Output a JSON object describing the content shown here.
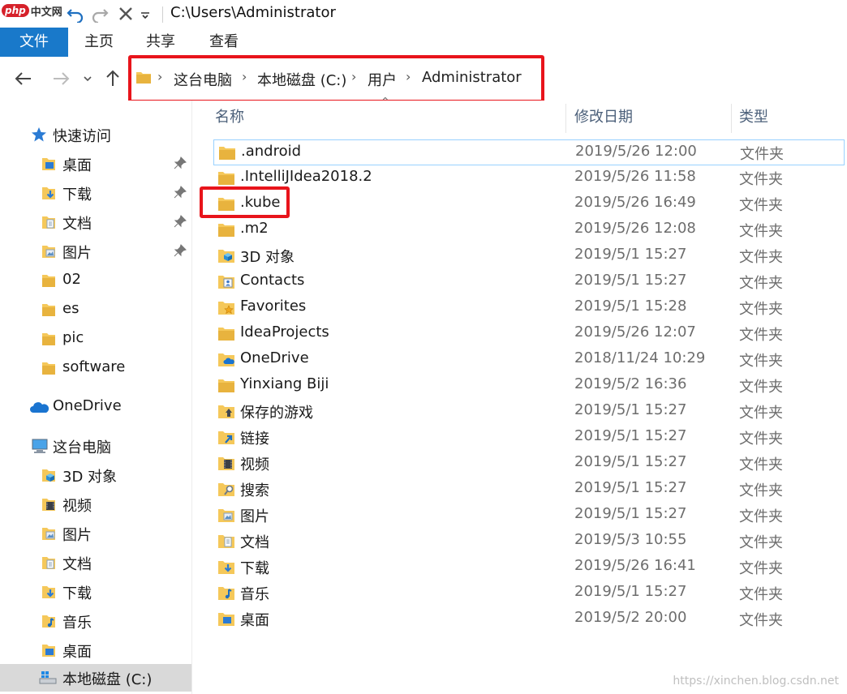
{
  "window": {
    "title": "C:\\Users\\Administrator"
  },
  "logo": {
    "badge": "php",
    "text": "中文网"
  },
  "ribbon": {
    "tabs": [
      "文件",
      "主页",
      "共享",
      "查看"
    ]
  },
  "address": {
    "breadcrumbs": [
      "这台电脑",
      "本地磁盘 (C:)",
      "用户",
      "Administrator"
    ]
  },
  "sidebar": {
    "quick_access": {
      "label": "快速访问",
      "items": [
        {
          "label": "桌面",
          "icon": "desktop-folder-icon",
          "pinned": true
        },
        {
          "label": "下载",
          "icon": "downloads-folder-icon",
          "pinned": true
        },
        {
          "label": "文档",
          "icon": "documents-folder-icon",
          "pinned": true
        },
        {
          "label": "图片",
          "icon": "pictures-folder-icon",
          "pinned": true
        },
        {
          "label": "02",
          "icon": "folder-icon",
          "pinned": false
        },
        {
          "label": "es",
          "icon": "folder-icon",
          "pinned": false
        },
        {
          "label": "pic",
          "icon": "folder-icon",
          "pinned": false
        },
        {
          "label": "software",
          "icon": "folder-icon",
          "pinned": false
        }
      ]
    },
    "onedrive": {
      "label": "OneDrive"
    },
    "this_pc": {
      "label": "这台电脑",
      "items": [
        {
          "label": "3D 对象",
          "icon": "3d-objects-folder-icon"
        },
        {
          "label": "视频",
          "icon": "videos-folder-icon"
        },
        {
          "label": "图片",
          "icon": "pictures-folder-icon"
        },
        {
          "label": "文档",
          "icon": "documents-folder-icon"
        },
        {
          "label": "下载",
          "icon": "downloads-folder-icon"
        },
        {
          "label": "音乐",
          "icon": "music-folder-icon"
        },
        {
          "label": "桌面",
          "icon": "desktop-folder-icon"
        },
        {
          "label": "本地磁盘 (C:)",
          "icon": "windows-drive-icon",
          "selected": true
        }
      ]
    }
  },
  "columns": {
    "name": "名称",
    "modified": "修改日期",
    "type": "类型"
  },
  "files": [
    {
      "name": ".android",
      "modified": "2019/5/26 12:00",
      "type": "文件夹",
      "icon": "folder-icon",
      "focused": true
    },
    {
      "name": ".IntelliJIdea2018.2",
      "modified": "2019/5/26 11:58",
      "type": "文件夹",
      "icon": "folder-icon"
    },
    {
      "name": ".kube",
      "modified": "2019/5/26 16:49",
      "type": "文件夹",
      "icon": "folder-icon",
      "highlighted": true
    },
    {
      "name": ".m2",
      "modified": "2019/5/26 12:08",
      "type": "文件夹",
      "icon": "folder-icon"
    },
    {
      "name": "3D 对象",
      "modified": "2019/5/1 15:27",
      "type": "文件夹",
      "icon": "3d-objects-folder-icon"
    },
    {
      "name": "Contacts",
      "modified": "2019/5/1 15:27",
      "type": "文件夹",
      "icon": "contacts-folder-icon"
    },
    {
      "name": "Favorites",
      "modified": "2019/5/1 15:28",
      "type": "文件夹",
      "icon": "favorites-folder-icon"
    },
    {
      "name": "IdeaProjects",
      "modified": "2019/5/26 12:07",
      "type": "文件夹",
      "icon": "folder-icon"
    },
    {
      "name": "OneDrive",
      "modified": "2018/11/24 10:29",
      "type": "文件夹",
      "icon": "onedrive-folder-icon"
    },
    {
      "name": "Yinxiang Biji",
      "modified": "2019/5/2 16:36",
      "type": "文件夹",
      "icon": "folder-icon"
    },
    {
      "name": "保存的游戏",
      "modified": "2019/5/1 15:27",
      "type": "文件夹",
      "icon": "saved-games-folder-icon"
    },
    {
      "name": "链接",
      "modified": "2019/5/1 15:27",
      "type": "文件夹",
      "icon": "links-folder-icon"
    },
    {
      "name": "视频",
      "modified": "2019/5/1 15:27",
      "type": "文件夹",
      "icon": "videos-folder-icon"
    },
    {
      "name": "搜索",
      "modified": "2019/5/1 15:27",
      "type": "文件夹",
      "icon": "searches-folder-icon"
    },
    {
      "name": "图片",
      "modified": "2019/5/1 15:27",
      "type": "文件夹",
      "icon": "pictures-folder-icon"
    },
    {
      "name": "文档",
      "modified": "2019/5/3 10:55",
      "type": "文件夹",
      "icon": "documents-folder-icon"
    },
    {
      "name": "下载",
      "modified": "2019/5/26 16:41",
      "type": "文件夹",
      "icon": "downloads-folder-icon"
    },
    {
      "name": "音乐",
      "modified": "2019/5/1 15:27",
      "type": "文件夹",
      "icon": "music-folder-icon"
    },
    {
      "name": "桌面",
      "modified": "2019/5/2 20:00",
      "type": "文件夹",
      "icon": "desktop-folder-icon"
    }
  ],
  "watermark": "https://xinchen.blog.csdn.net",
  "colors": {
    "accent": "#1979ca",
    "folder": "#f5c85a",
    "annotation_red": "#e8141b",
    "column_header_text": "#4c607a",
    "selection": "#d9d9d9",
    "focus_border": "#99d1ff"
  }
}
